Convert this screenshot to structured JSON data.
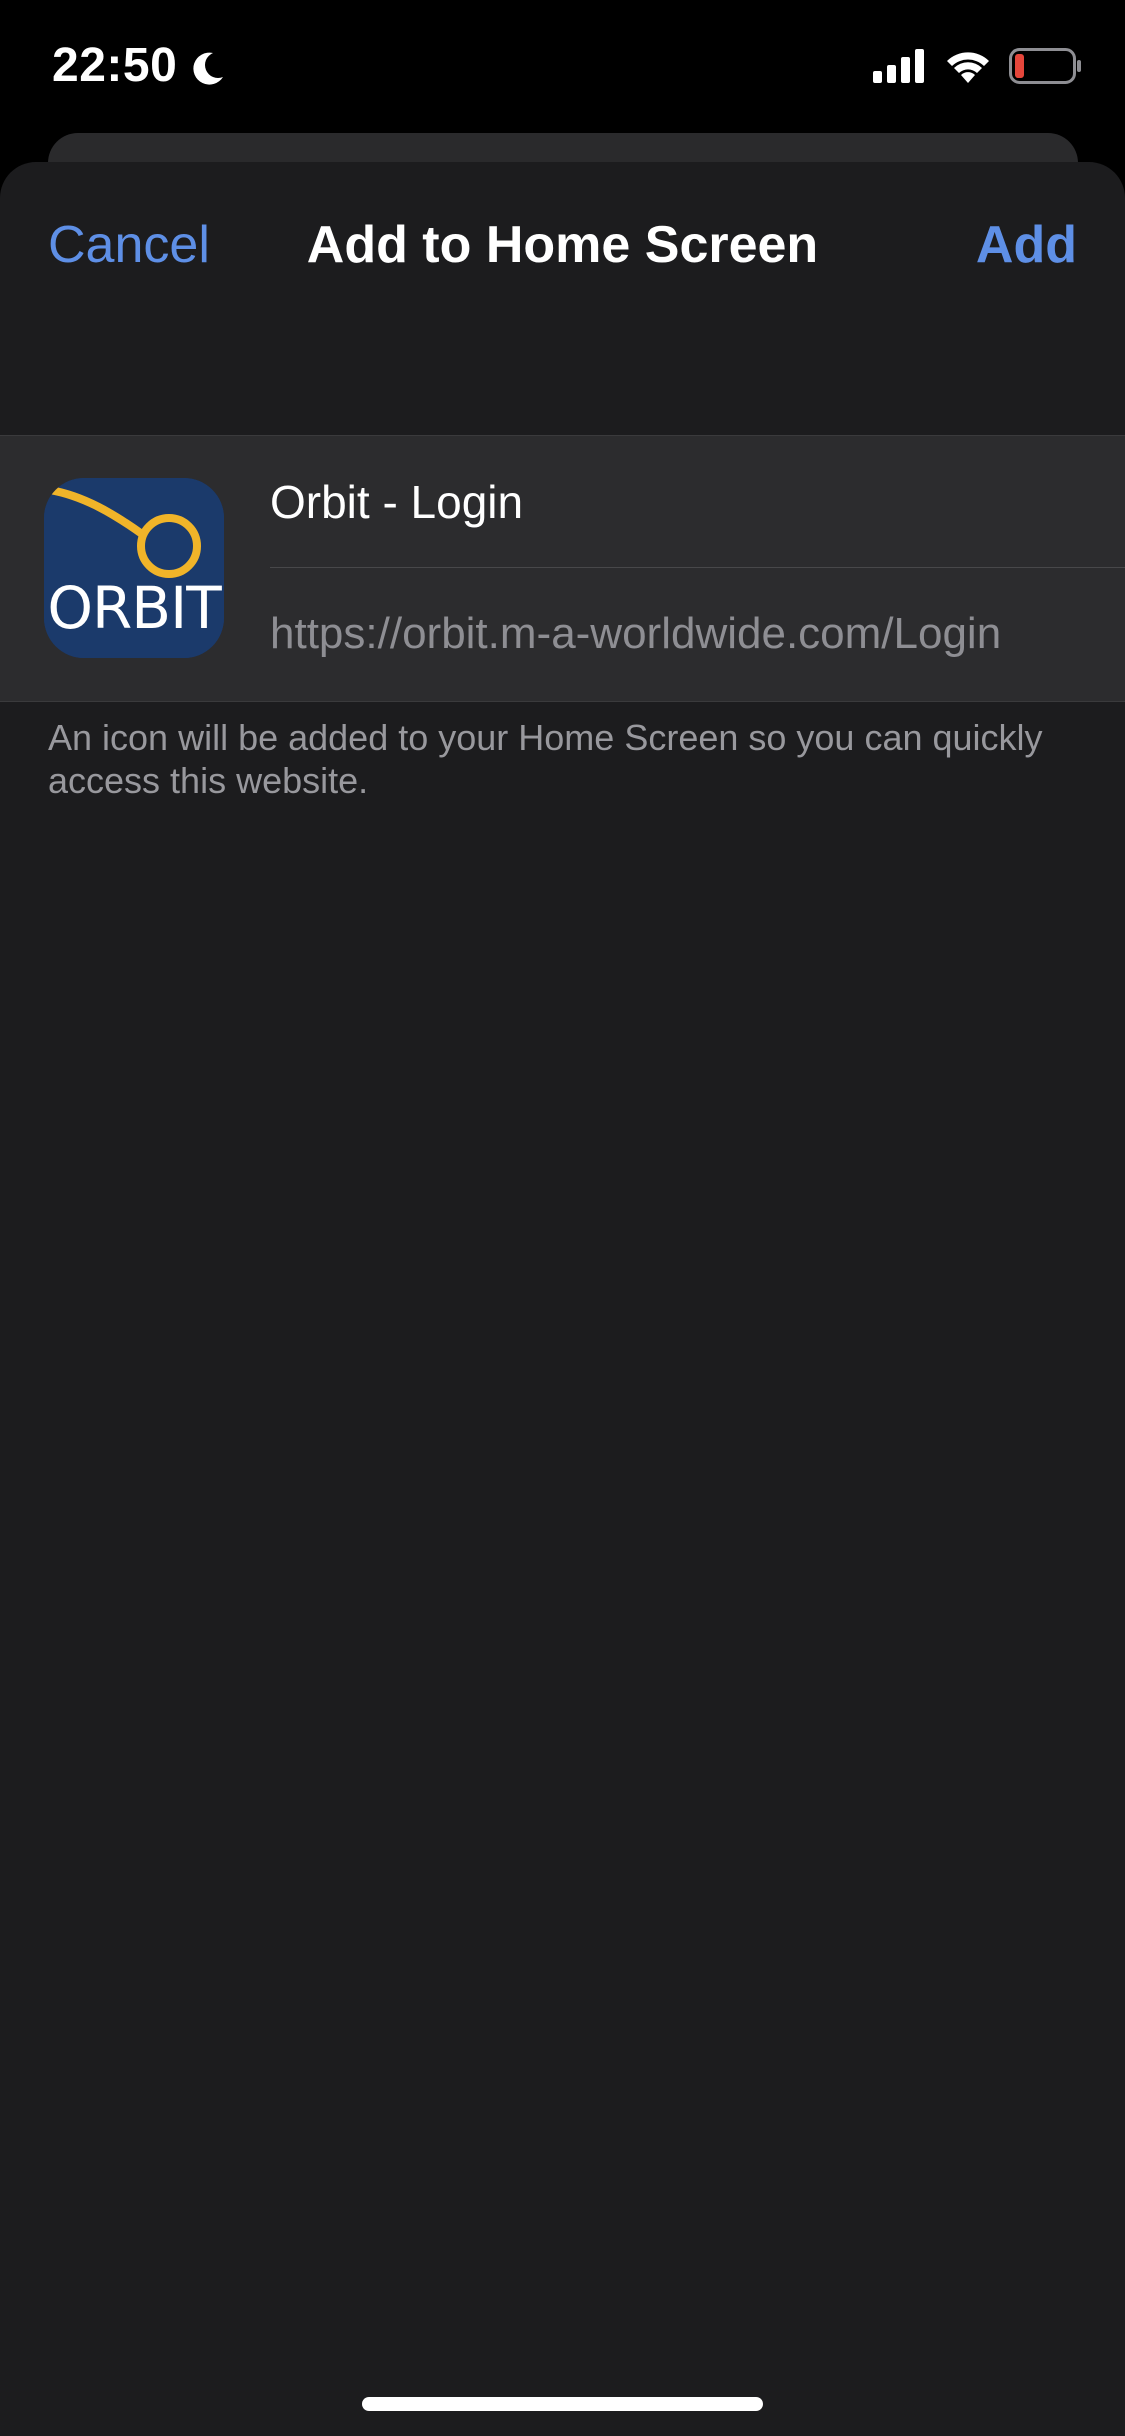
{
  "status_bar": {
    "time": "22:50"
  },
  "nav": {
    "cancel_label": "Cancel",
    "title": "Add to Home Screen",
    "add_label": "Add"
  },
  "bookmark": {
    "icon_wordmark": "ORBIT",
    "name": "Orbit - Login",
    "url": "https://orbit.m-a-worldwide.com/Login"
  },
  "footer_note": "An icon will be added to your Home Screen so you can quickly access this website.",
  "colors": {
    "accent": "#5e8fe6",
    "sheet_background": "#1c1c1e",
    "group_background": "#2c2c2e",
    "icon_background": "#1b3a6b",
    "icon_ring": "#f0b429",
    "battery_low": "#e5463b"
  },
  "icons": [
    "moon-icon",
    "cellular-signal-icon",
    "wifi-icon",
    "battery-icon"
  ]
}
